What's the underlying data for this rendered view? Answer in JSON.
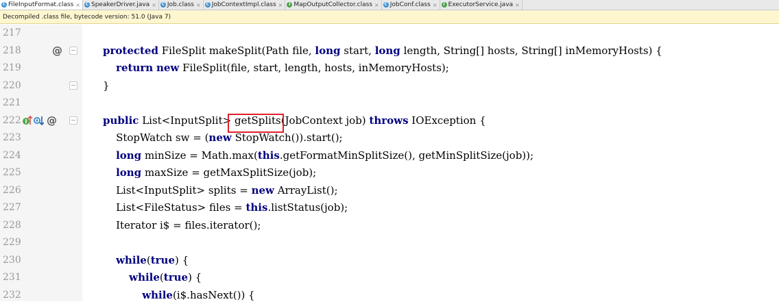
{
  "tabs": [
    {
      "label": "FileInputFormat.class",
      "icon": "class-file-icon",
      "color": "#3d8fd1",
      "active": true
    },
    {
      "label": "SpeakerDriver.java",
      "icon": "class-file-icon",
      "color": "#3d8fd1"
    },
    {
      "label": "Job.class",
      "icon": "class-file-icon",
      "color": "#3d8fd1"
    },
    {
      "label": "JobContextImpl.class",
      "icon": "class-file-icon",
      "color": "#3d8fd1"
    },
    {
      "label": "MapOutputCollector.class",
      "icon": "interface-file-icon",
      "color": "#4ea34e"
    },
    {
      "label": "JobConf.class",
      "icon": "class-file-icon",
      "color": "#3d8fd1"
    },
    {
      "label": "ExecutorService.java",
      "icon": "interface-file-icon",
      "color": "#4ea34e"
    }
  ],
  "banner": {
    "text": "Decompiled .class file, bytecode version: 51.0 (Java 7)"
  },
  "editor": {
    "lines": [
      {
        "num": "217",
        "code": ""
      },
      {
        "num": "218",
        "code": "protected FileSplit makeSplit(Path file, long start, long length, String[] hosts, String[] inMemoryHosts) {",
        "gutter": "override"
      },
      {
        "num": "219",
        "code": "    return new FileSplit(file, start, length, hosts, inMemoryHosts);"
      },
      {
        "num": "220",
        "code": "}",
        "gutter": "fold"
      },
      {
        "num": "221",
        "code": ""
      },
      {
        "num": "222",
        "code": "public List<InputSplit> getSplits(JobContext job) throws IOException {",
        "gutter": "implements"
      },
      {
        "num": "223",
        "code": "    StopWatch sw = (new StopWatch()).start();"
      },
      {
        "num": "224",
        "code": "    long minSize = Math.max(this.getFormatMinSplitSize(), getMinSplitSize(job));"
      },
      {
        "num": "225",
        "code": "    long maxSize = getMaxSplitSize(job);"
      },
      {
        "num": "226",
        "code": "    List<InputSplit> splits = new ArrayList();"
      },
      {
        "num": "227",
        "code": "    List<FileStatus> files = this.listStatus(job);"
      },
      {
        "num": "228",
        "code": "    Iterator i$ = files.iterator();"
      },
      {
        "num": "229",
        "code": ""
      },
      {
        "num": "230",
        "code": "    while(true) {"
      },
      {
        "num": "231",
        "code": "        while(true) {"
      },
      {
        "num": "232",
        "code": "            while(i$.hasNext()) {"
      }
    ],
    "keywords": [
      "protected",
      "public",
      "return",
      "new",
      "long",
      "this",
      "while",
      "true",
      "throws"
    ],
    "highlight": {
      "text": "getSplits",
      "color": "#e0202a"
    },
    "colors": {
      "keyword": "#000080",
      "linenumber": "#999999",
      "gutter": "#f5f5f5"
    }
  }
}
